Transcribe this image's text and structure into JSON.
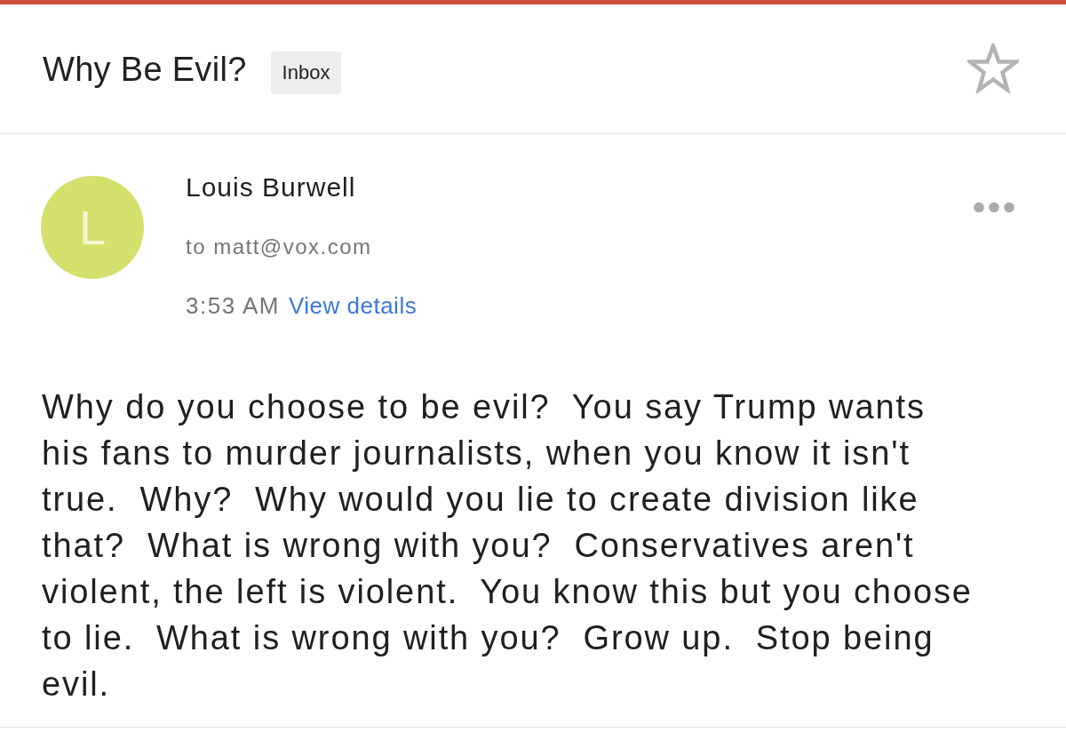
{
  "subject": {
    "title": "Why Be Evil?",
    "label": "Inbox",
    "starred": false
  },
  "message": {
    "avatar_letter": "L",
    "sender": "Louis Burwell",
    "recipient": "to matt@vox.com",
    "time": "3:53 AM",
    "details_link": "View details",
    "body": "Why do you choose to be evil?  You say Trump wants his fans to murder journalists, when you know it isn't true.  Why?  Why would you lie to create division like that?  What is wrong with you?  Conservatives aren't violent, the left is violent.  You know this but you choose to lie.  What is wrong with you?  Grow up.  Stop being evil."
  }
}
